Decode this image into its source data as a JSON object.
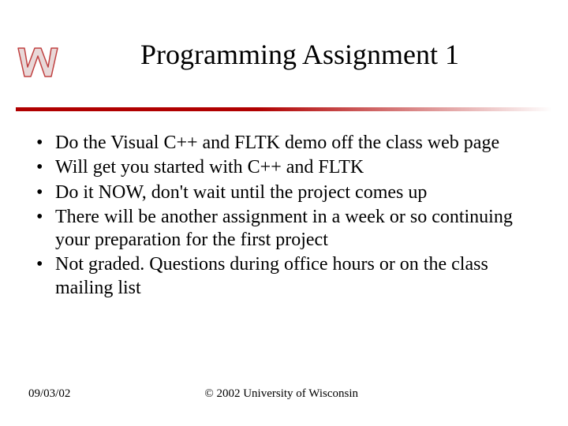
{
  "title": "Programming Assignment 1",
  "logo": {
    "name": "wisconsin-w-logo"
  },
  "bullets": [
    "Do the Visual C++ and FLTK demo off the class web page",
    "Will get you started with C++ and FLTK",
    "Do it NOW, don't wait until the project comes up",
    "There will be another assignment in a week or so continuing your preparation for the first project",
    "Not graded. Questions during office hours or on the class mailing list"
  ],
  "footer": {
    "date": "09/03/02",
    "copyright": "© 2002 University of Wisconsin"
  }
}
